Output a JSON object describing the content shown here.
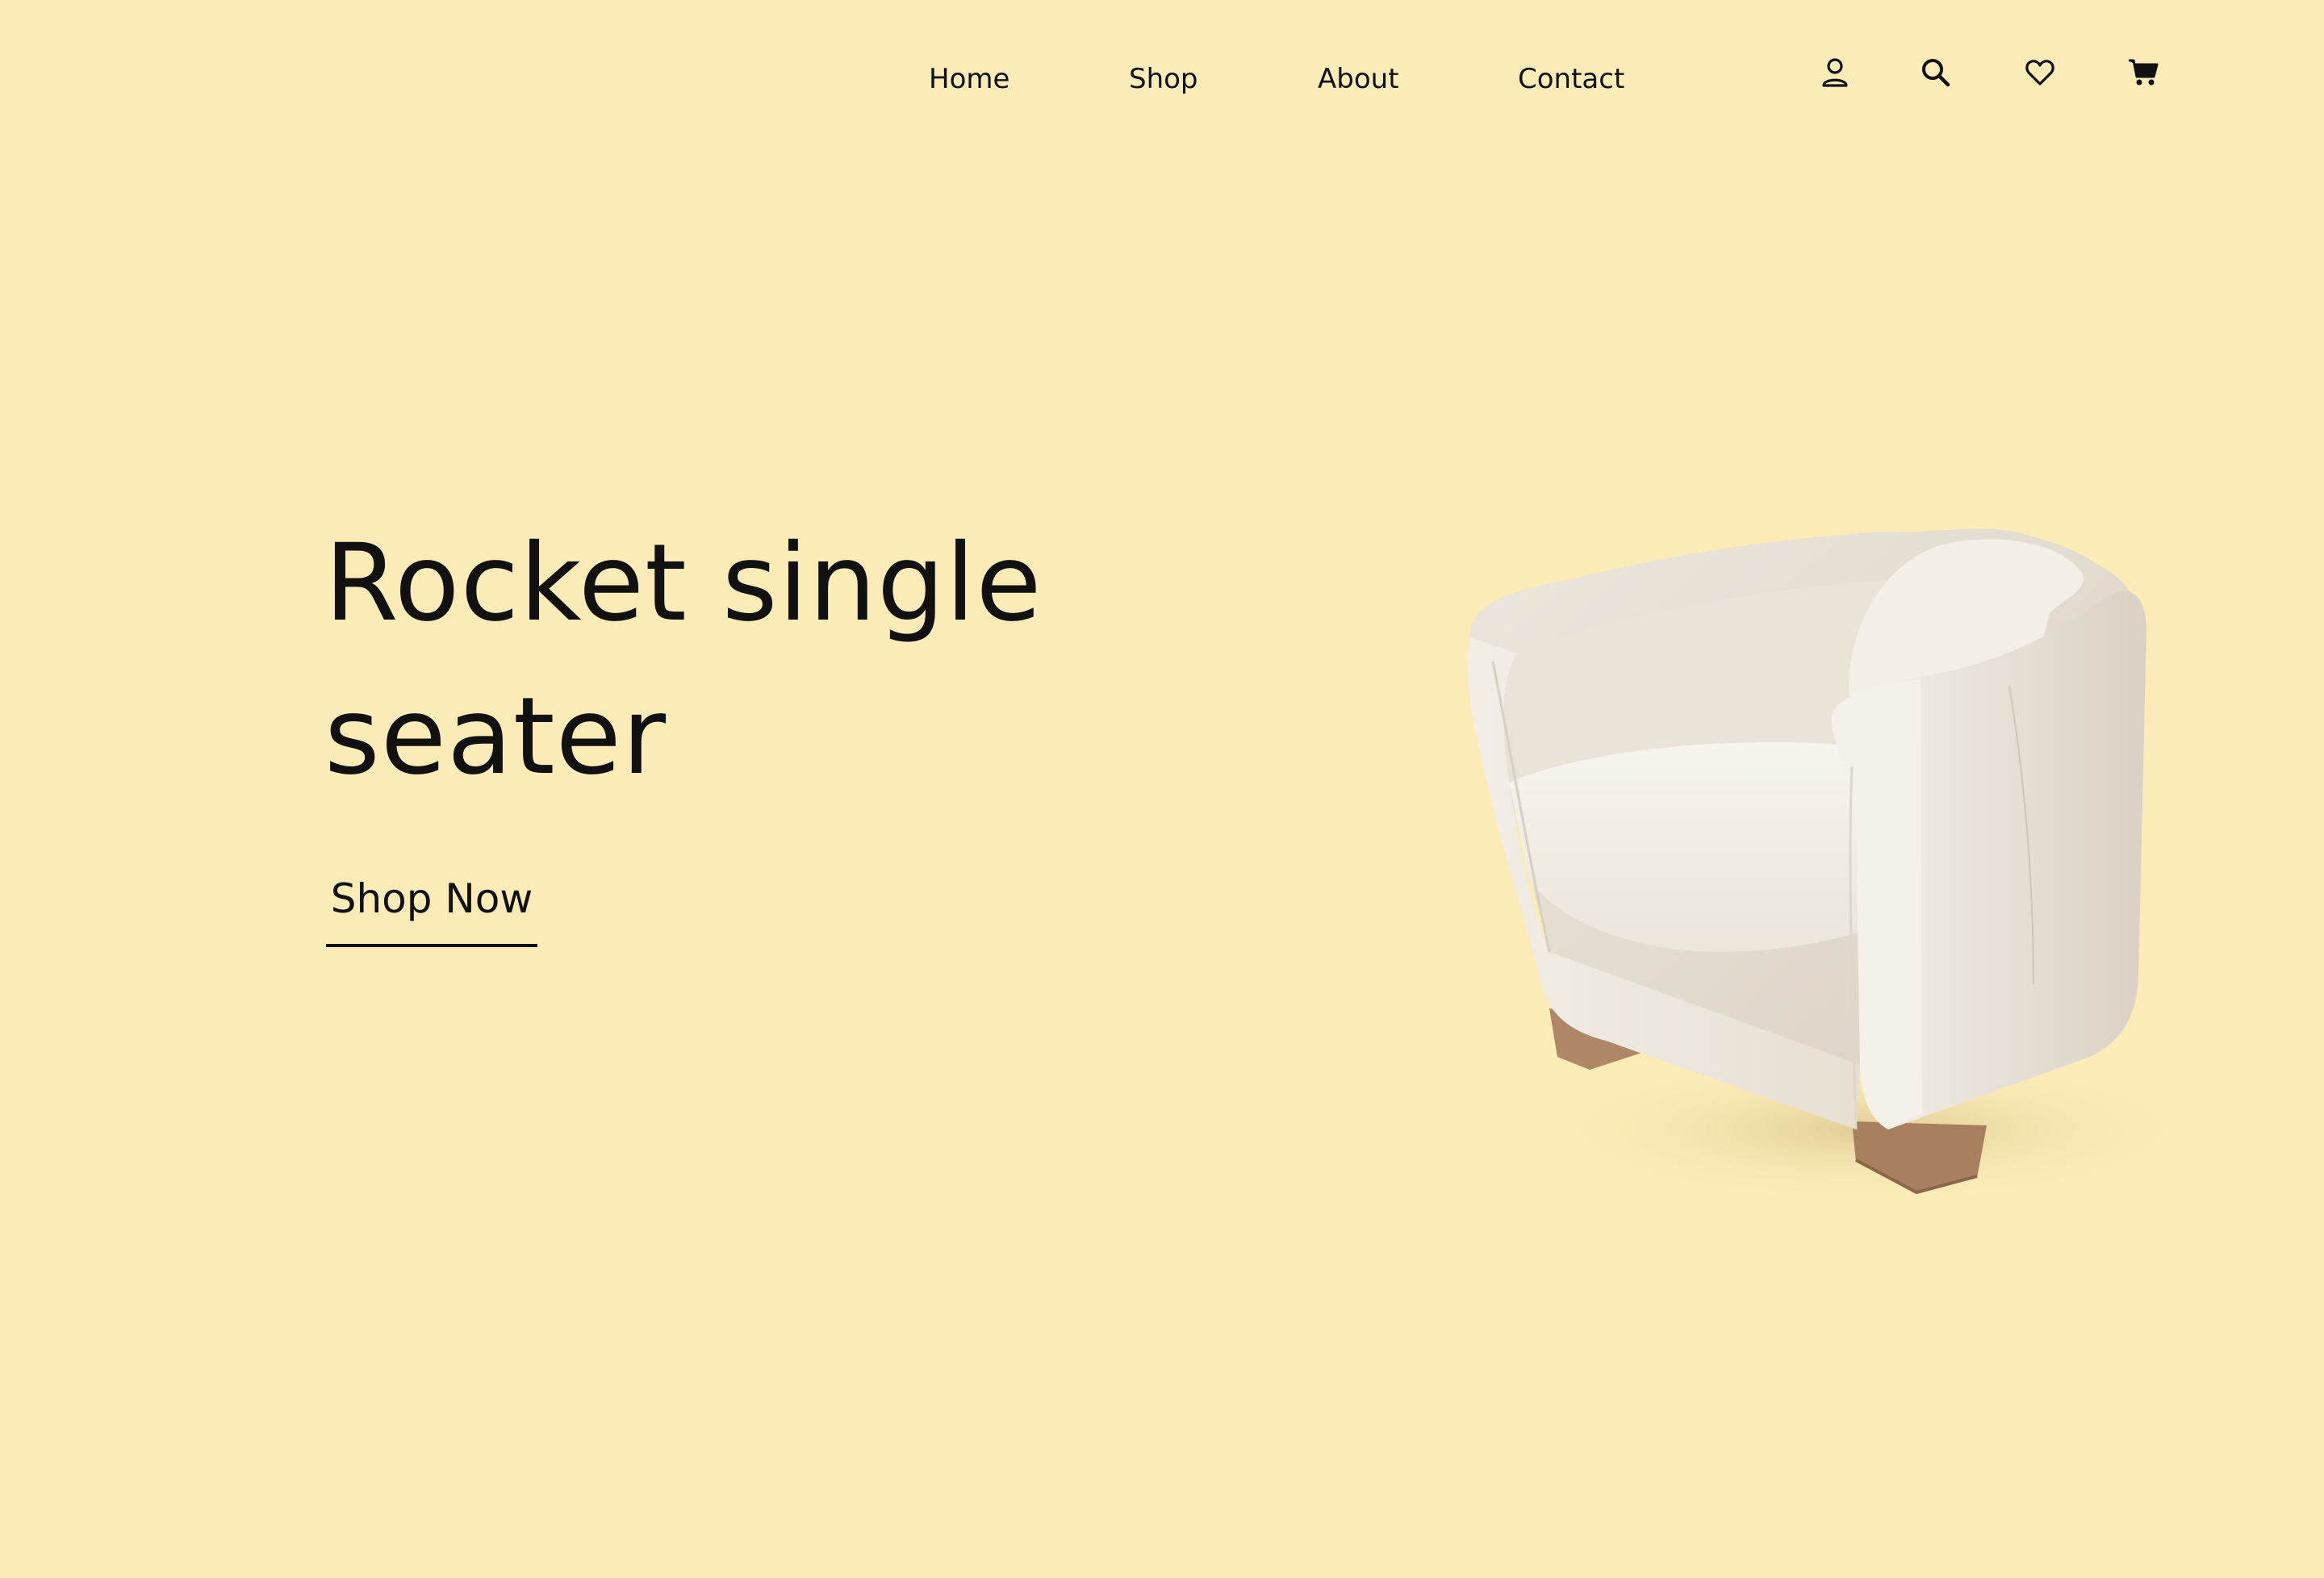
{
  "nav": {
    "links": [
      {
        "label": "Home"
      },
      {
        "label": "Shop"
      },
      {
        "label": "About"
      },
      {
        "label": "Contact"
      }
    ],
    "icons": [
      "user-icon",
      "search-icon",
      "heart-icon",
      "cart-icon"
    ]
  },
  "hero": {
    "title_line1": "Rocket single",
    "title_line2": "seater",
    "cta_label": "Shop Now"
  },
  "colors": {
    "background": "#fbebb6",
    "text": "#111111",
    "chair_fabric": "#f3efe7",
    "chair_legs": "#b08766"
  }
}
